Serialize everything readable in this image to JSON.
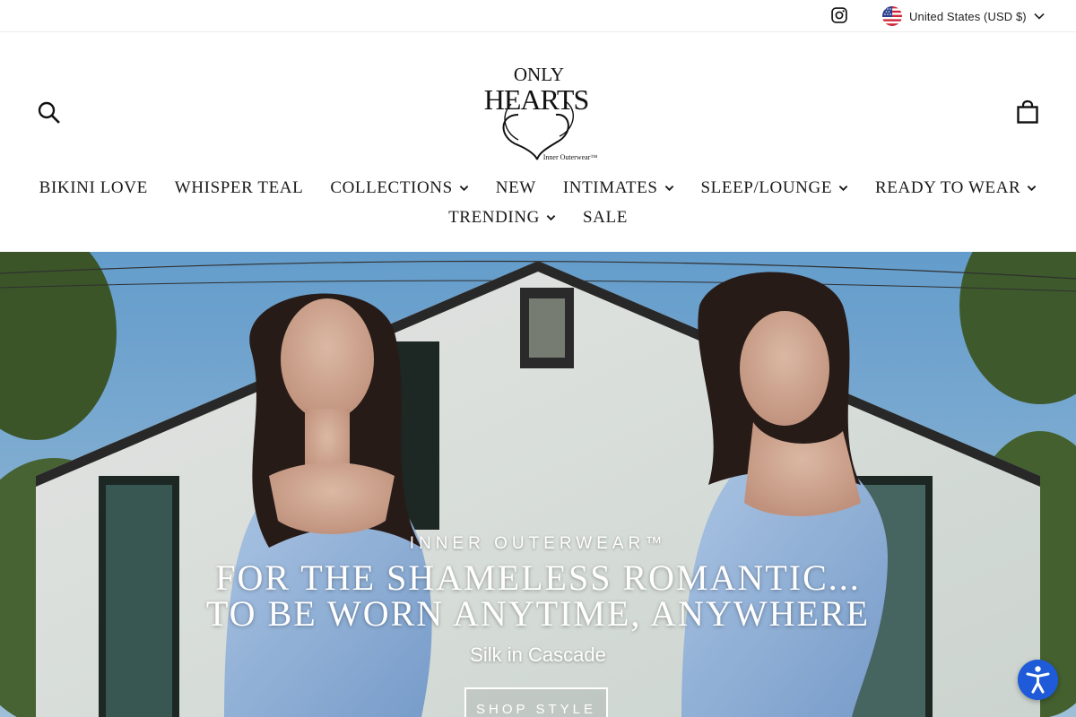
{
  "utility": {
    "instagram_icon": "instagram-icon",
    "region_label": "United States (USD $)",
    "flag_icon": "us-flag-icon"
  },
  "header": {
    "logo_icon": "only-hearts-logo",
    "logo_text_top": "ONLY",
    "logo_text_main": "HEARTS",
    "logo_tagline": "Inner Outerwear™",
    "search_icon": "search-icon",
    "cart_icon": "cart-icon"
  },
  "nav": {
    "row1": [
      {
        "label": "BIKINI LOVE",
        "has_dropdown": false
      },
      {
        "label": "WHISPER TEAL",
        "has_dropdown": false
      },
      {
        "label": "COLLECTIONS",
        "has_dropdown": true
      },
      {
        "label": "NEW",
        "has_dropdown": false
      },
      {
        "label": "INTIMATES",
        "has_dropdown": true
      },
      {
        "label": "SLEEP/LOUNGE",
        "has_dropdown": true
      },
      {
        "label": "READY TO WEAR",
        "has_dropdown": true
      }
    ],
    "row2": [
      {
        "label": "TRENDING",
        "has_dropdown": true
      },
      {
        "label": "SALE",
        "has_dropdown": false
      }
    ]
  },
  "hero": {
    "kicker": "INNER OUTERWEAR™",
    "title_line1": "FOR THE SHAMELESS ROMANTIC...",
    "title_line2": "TO BE WORN ANYTIME, ANYWHERE",
    "subtitle": "Silk in Cascade",
    "cta_label": "SHOP STYLE"
  },
  "widgets": {
    "accessibility_icon": "accessibility-icon"
  },
  "colors": {
    "text": "#1c1c1c",
    "sky": "#7fb3dc",
    "accessibility_blue": "#1f5bd8",
    "silk_blue": "#9cc0ea"
  }
}
